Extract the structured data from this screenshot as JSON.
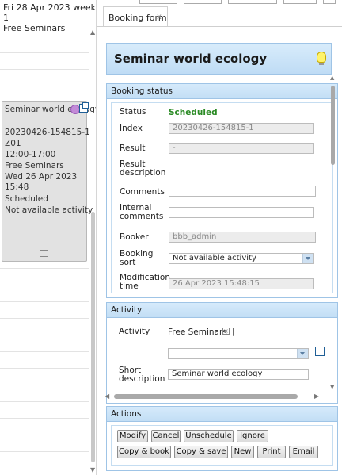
{
  "calendar": {
    "header_line1": "Fri 28 Apr 2023 week 1",
    "header_line2": "Free Seminars",
    "event": {
      "title": "Seminar world ecology",
      "index": "20230426-154815-1",
      "resource": "Z01",
      "time": "12:00-17:00",
      "activity": "Free Seminars",
      "modified": "Wed 26 Apr 2023 15:48",
      "status": "Scheduled",
      "sort": "Not available activity"
    }
  },
  "tab": {
    "label": "Booking form",
    "close": "x"
  },
  "form": {
    "title": "Seminar world ecology",
    "booking_status": {
      "heading": "Booking status",
      "status_label": "Status",
      "status_value": "Scheduled",
      "index_label": "Index",
      "index_value": "20230426-154815-1",
      "result_label": "Result",
      "result_value": "-",
      "result_desc_label": "Result description",
      "comments_label": "Comments",
      "comments_value": "",
      "internal_comments_label": "Internal comments",
      "internal_comments_value": "",
      "booker_label": "Booker",
      "booker_value": "bbb_admin",
      "booking_sort_label": "Booking sort",
      "booking_sort_value": "Not available activity",
      "mod_time_label": "Modification time",
      "mod_time_value": "26 Apr 2023 15:48:15"
    },
    "activity": {
      "heading": "Activity",
      "activity_label": "Activity",
      "activity_value": "Free Seminars",
      "activity_separator": "|",
      "select_value": "",
      "short_desc_label": "Short description",
      "short_desc_value": "Seminar world ecology"
    },
    "actions": {
      "heading": "Actions",
      "modify": "Modify",
      "cancel": "Cancel",
      "unschedule": "Unschedule",
      "ignore": "Ignore",
      "copy_book": "Copy & book",
      "copy_save": "Copy & save",
      "new": "New",
      "print": "Print",
      "email": "Email"
    }
  },
  "colors": {
    "status_green": "#2a8a24",
    "panel_blue": "#c2def5",
    "accent": "#1f5f96"
  }
}
